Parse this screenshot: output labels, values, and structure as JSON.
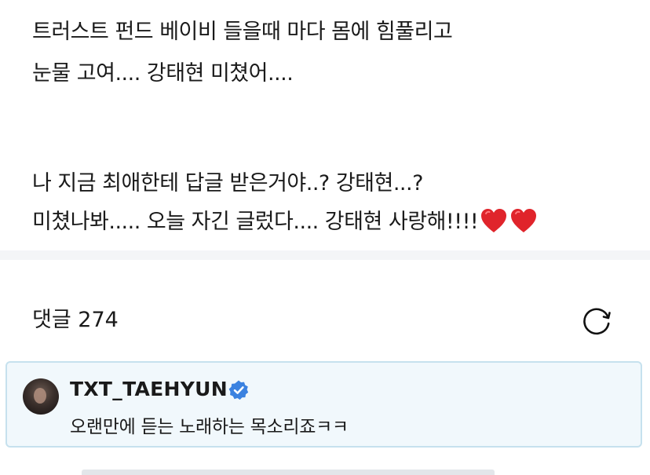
{
  "post": {
    "line1": "트러스트 펀드 베이비 들을때 마다 몸에 힘풀리고",
    "line2": "눈물 고여.... 강태현 미쳤어....",
    "line3": "나 지금 최애한테 답글 받은거야..? 강태현...?",
    "line4": "미쳤나봐..... 오늘 자긴 글렀다.... 강태현 사랑해!!!!"
  },
  "comments": {
    "label": "댓글 274",
    "refresh_icon": "refresh-icon"
  },
  "pinned_comment": {
    "username": "TXT_TAEHYUN",
    "verified_icon": "verified-badge-icon",
    "text": "오랜만에 듣는 노래하는 목소리죠ㅋㅋ"
  },
  "colors": {
    "heart": "#e0242b",
    "verified": "#3b82e0",
    "card_background": "#f1f8fc",
    "card_border": "#c6e1ee",
    "divider": "#f4f5f7"
  }
}
